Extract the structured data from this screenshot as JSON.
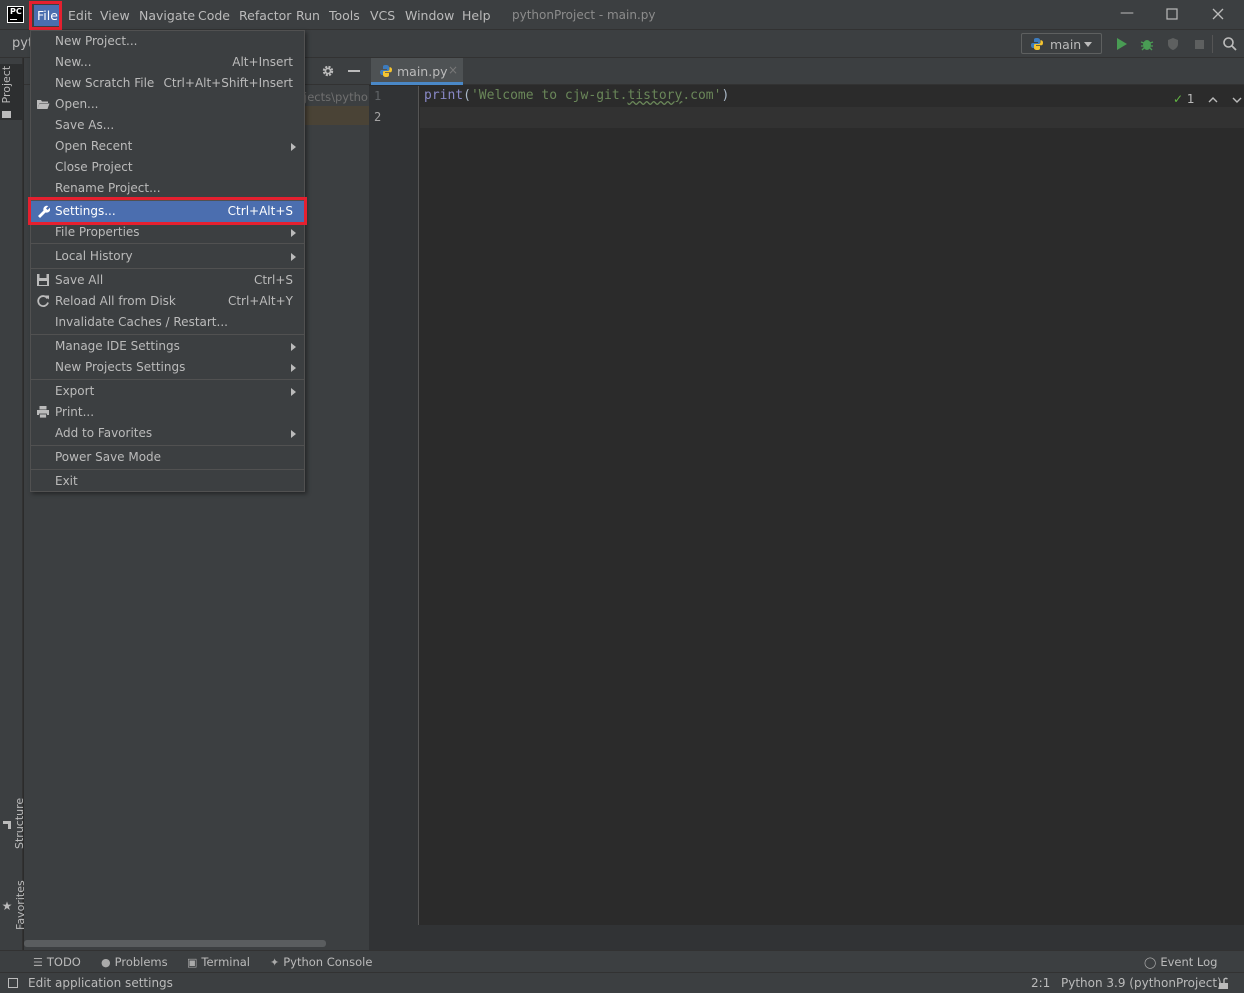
{
  "title_bar": {
    "logo_text": "PC",
    "menus": [
      "File",
      "Edit",
      "View",
      "Navigate",
      "Code",
      "Refactor",
      "Run",
      "Tools",
      "VCS",
      "Window",
      "Help"
    ],
    "window_title": "pythonProject - main.py"
  },
  "toolbar": {
    "project_name_partial": "pyt",
    "run_config": "main"
  },
  "side_tabs": {
    "project": "Project",
    "structure": "Structure",
    "favorites": "Favorites"
  },
  "project_panel": {
    "tree_path_partial": "jects\\pytho"
  },
  "editor": {
    "tab_label": "main.py",
    "tab_close": "×",
    "line_numbers": [
      "1",
      "2"
    ],
    "code_fn": "print",
    "code_open": "(",
    "code_str_prefix": "'Welcome to cjw-git.",
    "code_str_squiggle": "tistory",
    "code_str_suffix": ".com'",
    "code_close": ")",
    "inspection_count": "1"
  },
  "file_menu": {
    "items": [
      {
        "label": "New Project...",
        "shortcut": ""
      },
      {
        "label": "New...",
        "shortcut": "Alt+Insert"
      },
      {
        "label": "New Scratch File",
        "shortcut": "Ctrl+Alt+Shift+Insert"
      },
      {
        "label": "Open...",
        "shortcut": ""
      },
      {
        "label": "Save As...",
        "shortcut": ""
      },
      {
        "label": "Open Recent",
        "shortcut": ""
      },
      {
        "label": "Close Project",
        "shortcut": ""
      },
      {
        "label": "Rename Project...",
        "shortcut": ""
      },
      {
        "label": "Settings...",
        "shortcut": "Ctrl+Alt+S"
      },
      {
        "label": "File Properties",
        "shortcut": ""
      },
      {
        "label": "Local History",
        "shortcut": ""
      },
      {
        "label": "Save All",
        "shortcut": "Ctrl+S"
      },
      {
        "label": "Reload All from Disk",
        "shortcut": "Ctrl+Alt+Y"
      },
      {
        "label": "Invalidate Caches / Restart...",
        "shortcut": ""
      },
      {
        "label": "Manage IDE Settings",
        "shortcut": ""
      },
      {
        "label": "New Projects Settings",
        "shortcut": ""
      },
      {
        "label": "Export",
        "shortcut": ""
      },
      {
        "label": "Print...",
        "shortcut": ""
      },
      {
        "label": "Add to Favorites",
        "shortcut": ""
      },
      {
        "label": "Power Save Mode",
        "shortcut": ""
      },
      {
        "label": "Exit",
        "shortcut": ""
      }
    ]
  },
  "bottom_tools": {
    "todo": "TODO",
    "problems": "Problems",
    "terminal": "Terminal",
    "python_console": "Python Console",
    "event_log": "Event Log"
  },
  "status_bar": {
    "message": "Edit application settings",
    "position": "2:1",
    "interpreter": "Python 3.9 (pythonProject)"
  },
  "colors": {
    "accent_selection": "#4b6eaf",
    "highlight_box": "#e5202f",
    "panel_bg": "#3c3f41",
    "editor_bg": "#2b2b2b"
  }
}
